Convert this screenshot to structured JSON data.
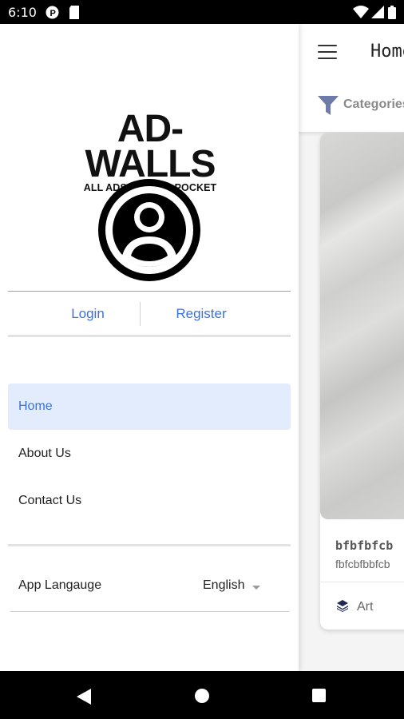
{
  "status_bar": {
    "time": "6:10",
    "icons": [
      "notification-p-icon",
      "sim-card-icon",
      "wifi-icon",
      "signal-icon",
      "battery-icon"
    ]
  },
  "background_app": {
    "title": "Home",
    "category_label": "Categories",
    "card": {
      "title": "bfbfbfcb",
      "description": "fbfcbfbbfcb",
      "category": "Art"
    }
  },
  "drawer": {
    "logo": {
      "main": "AD-WALLS",
      "tagline": "ALL ADS IN YOUR POCKET"
    },
    "login_label": "Login",
    "register_label": "Register",
    "nav_items": [
      {
        "label": "Home",
        "active": true
      },
      {
        "label": "About Us",
        "active": false
      },
      {
        "label": "Contact Us",
        "active": false
      }
    ],
    "language": {
      "label": "App Langauge",
      "selected": "English"
    }
  },
  "colors": {
    "accent": "#3b73d8",
    "active_bg": "#e3ecfc"
  }
}
